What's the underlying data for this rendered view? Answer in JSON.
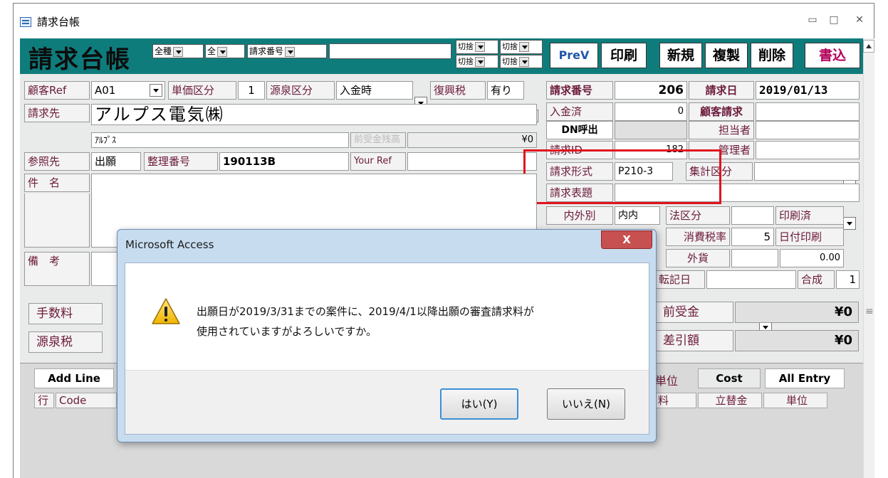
{
  "window": {
    "title": "請求台帳",
    "minimize": "▭",
    "maximize": "□",
    "close": "✕"
  },
  "header": {
    "form_title": "請求台帳",
    "filter1": "全種",
    "filter2": "全",
    "search_field": "請求番号",
    "toggle_label": "切捨",
    "buttons": {
      "prev": "PreV",
      "print": "印刷",
      "new": "新規",
      "copy": "複製",
      "delete": "削除",
      "write": "書込"
    }
  },
  "form": {
    "customer_ref_label": "顧客Ref",
    "customer_ref_value": "A01",
    "price_class_label": "単価区分",
    "price_class_value": "1",
    "withholding_class_label": "源泉区分",
    "withholding_class_value": "入金時",
    "reconstruction_tax_label": "復興税",
    "reconstruction_tax_value": "有り",
    "billing_to_label": "請求先",
    "billing_to_value": "アルプス電気㈱",
    "billing_to_kana": "ｱﾙﾌﾟｽ",
    "advance_balance_label": "前受金残高",
    "advance_balance_value": "¥0",
    "reference_label": "参照先",
    "reference_value": "出願",
    "ref_number_label": "整理番号",
    "ref_number_value": "190113B",
    "your_ref_label": "Your Ref",
    "subject_label": "件　名",
    "remarks_label": "備　考",
    "invoice_no_label": "請求番号",
    "invoice_no_value": "206",
    "invoice_date_label": "請求日",
    "invoice_date_value": "2019/01/13",
    "paid_label": "入金済",
    "paid_amount": "0",
    "customer_billing_label": "顧客請求",
    "dn_call_label": "DN呼出",
    "staff_label": "担当者",
    "invoice_id_label": "請求ID",
    "invoice_id_value": "182",
    "manager_label": "管理者",
    "invoice_format_label": "請求形式",
    "invoice_format_value": "P210-3",
    "aggregate_class_label": "集計区分",
    "invoice_heading_label": "請求表題",
    "domestic_label": "内外別",
    "domestic_value": "内内",
    "legal_class_label": "法区分",
    "printed_label": "印刷済",
    "tax_rate_label": "消費税率",
    "tax_rate_value": "5",
    "date_print_label": "日付印刷",
    "currency_label": "外貨",
    "currency_value": "0.00",
    "transfer_date_label": "転記日",
    "synth_label": "合成",
    "synth_value": "1",
    "fee_label": "手数料",
    "withholding_tax_label": "源泉税",
    "advance_label": "前受金",
    "advance_value": "¥0",
    "balance_label": "差引額",
    "balance_value": "¥0"
  },
  "grid": {
    "add_line": "Add Line",
    "unit_tab": "単位",
    "cost_tab": "Cost",
    "all_entry_tab": "All Entry",
    "col_row": "行",
    "col_code": "Code",
    "col_fee_tail": "料",
    "col_advance": "立替金",
    "col_unit": "単位"
  },
  "dialog": {
    "title": "Microsoft Access",
    "close": "X",
    "message_line1": "出願日が2019/3/31までの案件に、2019/4/1以降出願の審査請求料が",
    "message_line2": "使用されていますがよろしいですか。",
    "yes_button": "はい(Y)",
    "no_button": "いいえ(N)"
  },
  "colors": {
    "header_teal": "#0f7c7c",
    "label_text": "#6b1a3a",
    "highlight_red": "#e0141e"
  }
}
